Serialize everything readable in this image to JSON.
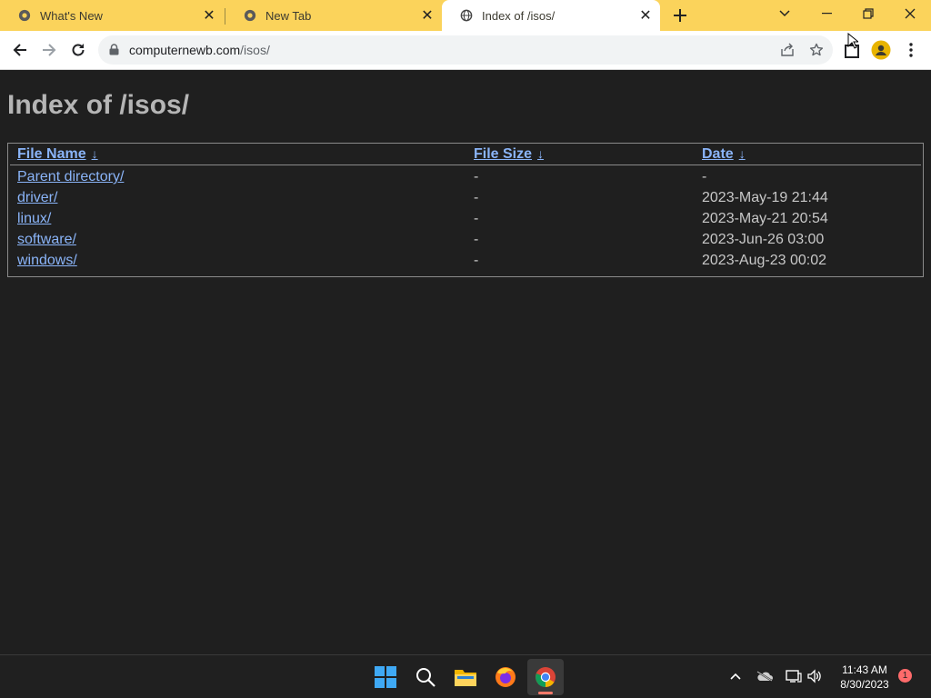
{
  "browser": {
    "tabs": [
      {
        "title": "What's New",
        "active": false
      },
      {
        "title": "New Tab",
        "active": false
      },
      {
        "title": "Index of /isos/",
        "active": true
      }
    ],
    "url": {
      "domain": "computernewb.com",
      "path": "/isos/"
    }
  },
  "page": {
    "heading": "Index of /isos/",
    "columns": {
      "name": "File Name",
      "size": "File Size",
      "date": "Date",
      "sort_arrow": "↓"
    },
    "rows": [
      {
        "name": "Parent directory/",
        "size": "-",
        "date": "-"
      },
      {
        "name": "driver/",
        "size": "-",
        "date": "2023-May-19 21:44"
      },
      {
        "name": "linux/",
        "size": "-",
        "date": "2023-May-21 20:54"
      },
      {
        "name": "software/",
        "size": "-",
        "date": "2023-Jun-26 03:00"
      },
      {
        "name": "windows/",
        "size": "-",
        "date": "2023-Aug-23 00:02"
      }
    ]
  },
  "taskbar": {
    "apps": [
      "windows-start",
      "search",
      "file-explorer",
      "firefox",
      "chrome"
    ],
    "clock": {
      "time": "11:43 AM",
      "date": "8/30/2023"
    },
    "notification_count": "1"
  },
  "colors": {
    "tabstrip": "#fbd35b",
    "page_bg": "#1f1f1f",
    "link": "#8ab4f8",
    "heading": "#b5b5b5"
  }
}
